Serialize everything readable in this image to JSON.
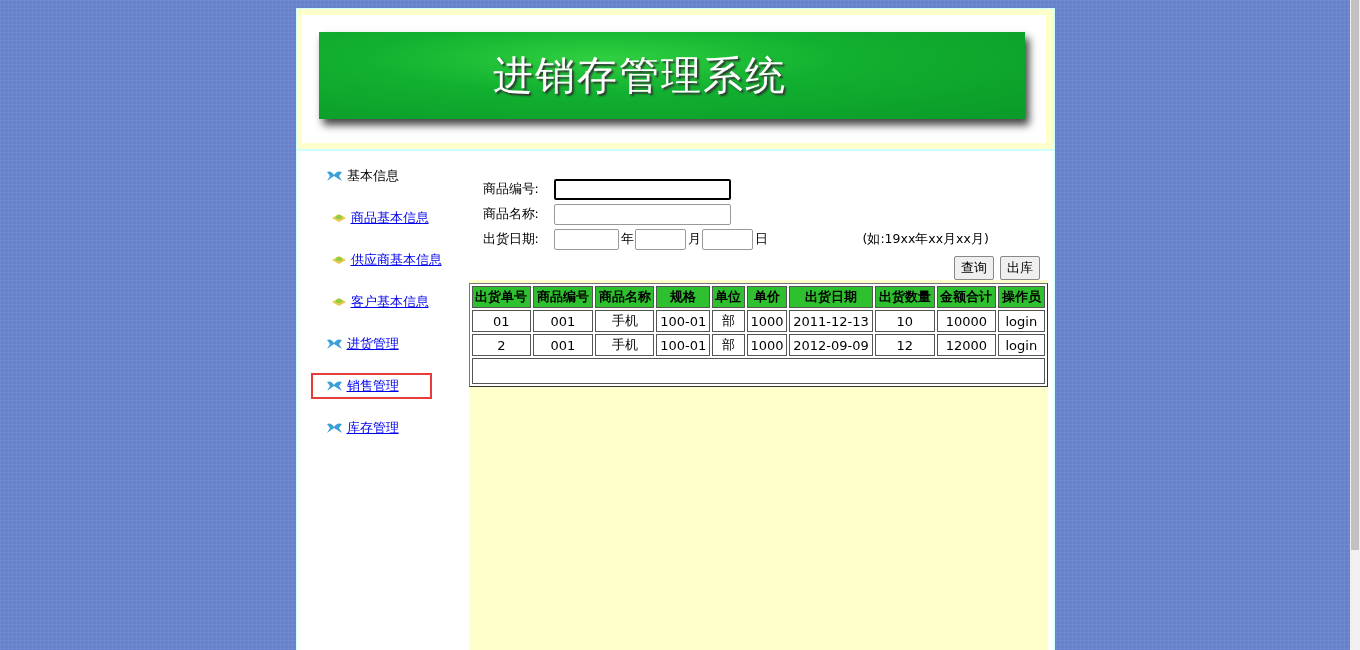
{
  "header": {
    "title": "进销存管理系统"
  },
  "sidebar": {
    "items": [
      {
        "kind": "group",
        "label": "基本信息",
        "link": false,
        "selected": false
      },
      {
        "kind": "sub",
        "label": "商品基本信息",
        "link": true,
        "selected": false
      },
      {
        "kind": "sub",
        "label": "供应商基本信息",
        "link": true,
        "selected": false
      },
      {
        "kind": "sub",
        "label": "客户基本信息",
        "link": true,
        "selected": false
      },
      {
        "kind": "group",
        "label": "进货管理",
        "link": true,
        "selected": false
      },
      {
        "kind": "group",
        "label": "销售管理",
        "link": true,
        "selected": true
      },
      {
        "kind": "group",
        "label": "库存管理",
        "link": true,
        "selected": false
      }
    ]
  },
  "form": {
    "fields": [
      {
        "kind": "text",
        "label": "商品编号:",
        "focused": true
      },
      {
        "kind": "text",
        "label": "商品名称:",
        "focused": false
      },
      {
        "kind": "date",
        "label": "出货日期:",
        "focused": false,
        "units": [
          "年",
          "月",
          "日"
        ],
        "hint": "(如:19xx年xx月xx月)"
      }
    ],
    "buttons": [
      "查询",
      "出库"
    ]
  },
  "table": {
    "columns": [
      "出货单号",
      "商品编号",
      "商品名称",
      "规格",
      "单位",
      "单价",
      "出货日期",
      "出货数量",
      "金额合计",
      "操作员"
    ],
    "rows": [
      [
        "01",
        "001",
        "手机",
        "100-01",
        "部",
        "1000",
        "2011-12-13",
        "10",
        "10000",
        "login"
      ],
      [
        "2",
        "001",
        "手机",
        "100-01",
        "部",
        "1000",
        "2012-09-09",
        "12",
        "12000",
        "login"
      ]
    ]
  }
}
